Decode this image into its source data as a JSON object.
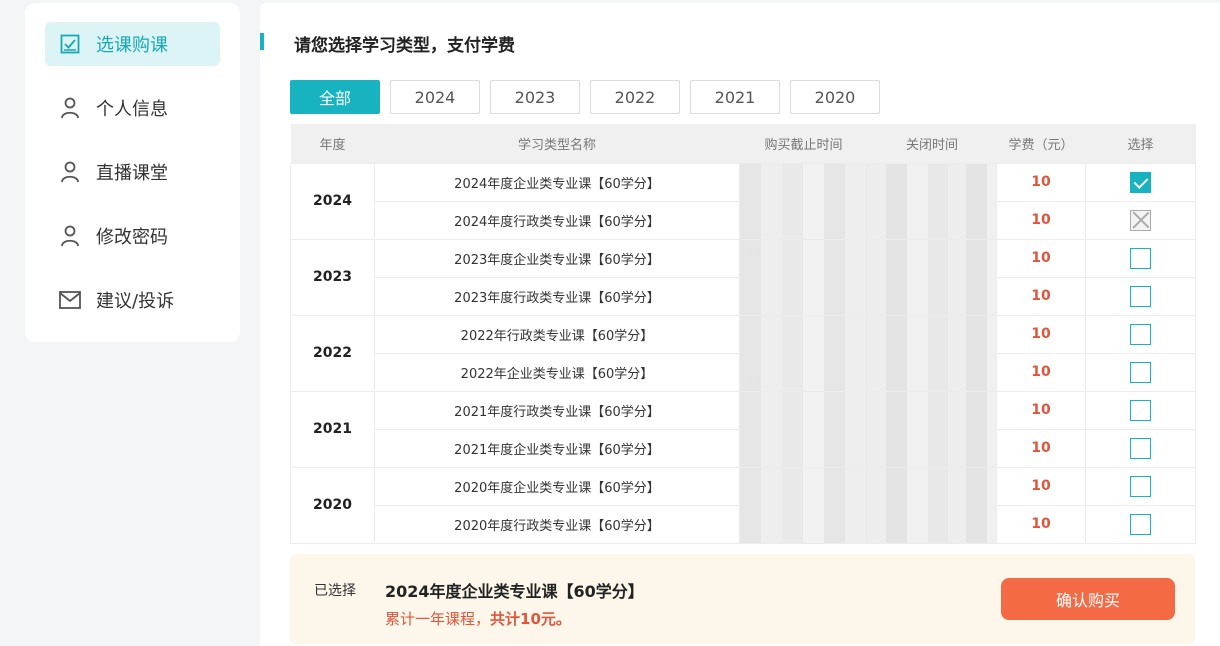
{
  "sidebar": {
    "items": [
      {
        "label": "选课购课",
        "icon": "check-square-icon",
        "active": true
      },
      {
        "label": "个人信息",
        "icon": "user-icon"
      },
      {
        "label": "直播课堂",
        "icon": "user-icon"
      },
      {
        "label": "修改密码",
        "icon": "user-icon"
      },
      {
        "label": "建议/投诉",
        "icon": "mail-icon"
      }
    ]
  },
  "main": {
    "title": "请您选择学习类型，支付学费",
    "tabs": [
      "全部",
      "2024",
      "2023",
      "2022",
      "2021",
      "2020"
    ],
    "active_tab": "全部",
    "table": {
      "headers": [
        "年度",
        "学习类型名称",
        "购买截止时间",
        "关闭时间",
        "学费（元）",
        "选择"
      ],
      "groups": [
        {
          "year": "2024",
          "rows": [
            {
              "name": "2024年度企业类专业课【60学分】",
              "fee": "10",
              "state": "checked"
            },
            {
              "name": "2024年度行政类专业课【60学分】",
              "fee": "10",
              "state": "disabled"
            }
          ]
        },
        {
          "year": "2023",
          "rows": [
            {
              "name": "2023年度企业类专业课【60学分】",
              "fee": "10",
              "state": "unchecked"
            },
            {
              "name": "2023年度行政类专业课【60学分】",
              "fee": "10",
              "state": "unchecked"
            }
          ]
        },
        {
          "year": "2022",
          "rows": [
            {
              "name": "2022年行政类专业课【60学分】",
              "fee": "10",
              "state": "unchecked"
            },
            {
              "name": "2022年企业类专业课【60学分】",
              "fee": "10",
              "state": "unchecked"
            }
          ]
        },
        {
          "year": "2021",
          "rows": [
            {
              "name": "2021年度行政类专业课【60学分】",
              "fee": "10",
              "state": "unchecked"
            },
            {
              "name": "2021年度企业类专业课【60学分】",
              "fee": "10",
              "state": "unchecked"
            }
          ]
        },
        {
          "year": "2020",
          "rows": [
            {
              "name": "2020年度企业类专业课【60学分】",
              "fee": "10",
              "state": "unchecked"
            },
            {
              "name": "2020年度行政类专业课【60学分】",
              "fee": "10",
              "state": "unchecked"
            }
          ]
        }
      ]
    }
  },
  "summary": {
    "label": "已选择",
    "course": "2024年度企业类专业课【60学分】",
    "note_prefix": "累计一年课程，",
    "note_total": "共计10元。",
    "confirm_label": "确认购买"
  },
  "colors": {
    "accent": "#17b3c1",
    "fee": "#e0553b",
    "confirm": "#f36a45",
    "summary_bg": "#fdf6ea"
  }
}
